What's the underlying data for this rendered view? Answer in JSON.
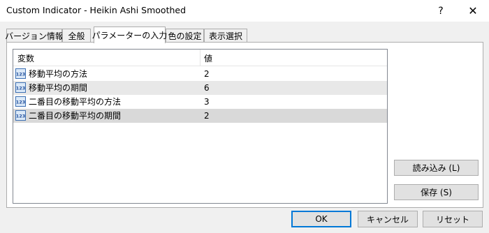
{
  "window": {
    "title": "Custom Indicator - Heikin Ashi Smoothed",
    "help_label": "?",
    "close_label": "✕"
  },
  "tabs": [
    {
      "label": "バージョン情報",
      "active": false
    },
    {
      "label": "全般",
      "active": false
    },
    {
      "label": "パラメーターの入力",
      "active": true
    },
    {
      "label": "色の設定",
      "active": false
    },
    {
      "label": "表示選択",
      "active": false
    }
  ],
  "grid": {
    "headers": {
      "variable": "変数",
      "value": "値"
    },
    "icon": "int-123-icon",
    "rows": [
      {
        "name": "移動平均の方法",
        "value": "2"
      },
      {
        "name": "移動平均の期間",
        "value": "6"
      },
      {
        "name": "二番目の移動平均の方法",
        "value": "3"
      },
      {
        "name": "二番目の移動平均の期間",
        "value": "2"
      }
    ]
  },
  "side_buttons": {
    "load": "読み込み (L)",
    "save": "保存 (S)"
  },
  "footer_buttons": {
    "ok": "OK",
    "cancel": "キャンセル",
    "reset": "リセット"
  },
  "colors": {
    "accent": "#0078d7",
    "row_alt": "#e8e8e8",
    "row_selected": "#d9d9d9"
  }
}
